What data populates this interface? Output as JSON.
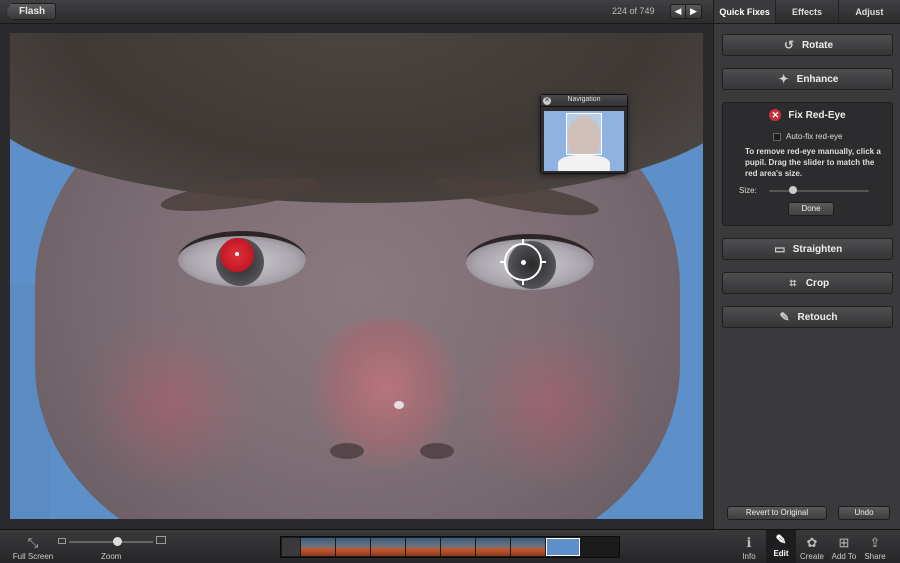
{
  "topbar": {
    "back_label": "Flash",
    "counter": "224 of 749",
    "prev_glyph": "◀",
    "next_glyph": "▶"
  },
  "navigation": {
    "title": "Navigation",
    "close_glyph": "✕"
  },
  "panel": {
    "tabs": [
      "Quick Fixes",
      "Effects",
      "Adjust"
    ],
    "rotate_label": "Rotate",
    "enhance_label": "Enhance",
    "fix_redeye_label": "Fix Red-Eye",
    "autofix_label": "Auto-fix red-eye",
    "help_text": "To remove red-eye manually, click a pupil. Drag the slider to match the red area's size.",
    "size_label": "Size:",
    "done_label": "Done",
    "straighten_label": "Straighten",
    "crop_label": "Crop",
    "retouch_label": "Retouch",
    "revert_label": "Revert to Original",
    "undo_label": "Undo"
  },
  "bottombar": {
    "fullscreen_label": "Full Screen",
    "zoom_label": "Zoom",
    "info_label": "Info",
    "edit_label": "Edit",
    "create_label": "Create",
    "addto_label": "Add To",
    "share_label": "Share"
  },
  "icons": {
    "rotate": "↺",
    "enhance": "✦",
    "fix_redeye": "✕",
    "straighten": "▭",
    "crop": "⌗",
    "retouch": "✎",
    "fullscreen": "⤡",
    "info": "ℹ",
    "edit": "✎",
    "create": "✿",
    "addto": "⊞",
    "share": "⇪"
  },
  "colors": {
    "accent_red": "#c8303a",
    "panel_bg": "#3a3a3c"
  }
}
